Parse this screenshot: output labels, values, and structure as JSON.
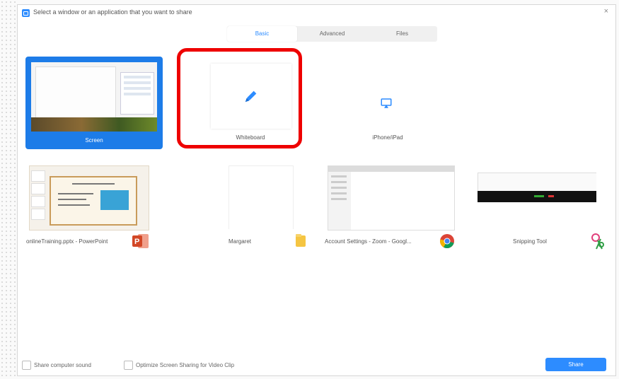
{
  "dialog": {
    "title": "Select a window or an application that you want to share",
    "close_glyph": "×"
  },
  "tabs": [
    {
      "label": "Basic",
      "active": true
    },
    {
      "label": "Advanced",
      "active": false
    },
    {
      "label": "Files",
      "active": false
    }
  ],
  "tiles_top": {
    "screen": {
      "label": "Screen",
      "selected": true
    },
    "whiteboard": {
      "label": "Whiteboard",
      "icon": "pencil-icon",
      "highlighted": true
    },
    "iphone_ipad": {
      "label": "iPhone/iPad",
      "icon": "airplay-icon"
    }
  },
  "tiles_windows": [
    {
      "label": "onlineTraining.pptx - PowerPoint",
      "badge": "powerpoint-icon"
    },
    {
      "label": "Margaret",
      "badge": "file-explorer-icon"
    },
    {
      "label": "Account Settings - Zoom - Googl...",
      "badge": "chrome-icon"
    },
    {
      "label": "Snipping Tool",
      "badge": "snipping-tool-icon"
    }
  ],
  "footer": {
    "share_sound_label": "Share computer sound",
    "optimize_label": "Optimize Screen Sharing for Video Clip",
    "share_button": "Share"
  },
  "colors": {
    "accent": "#2d8cff",
    "highlight": "#e00000"
  }
}
